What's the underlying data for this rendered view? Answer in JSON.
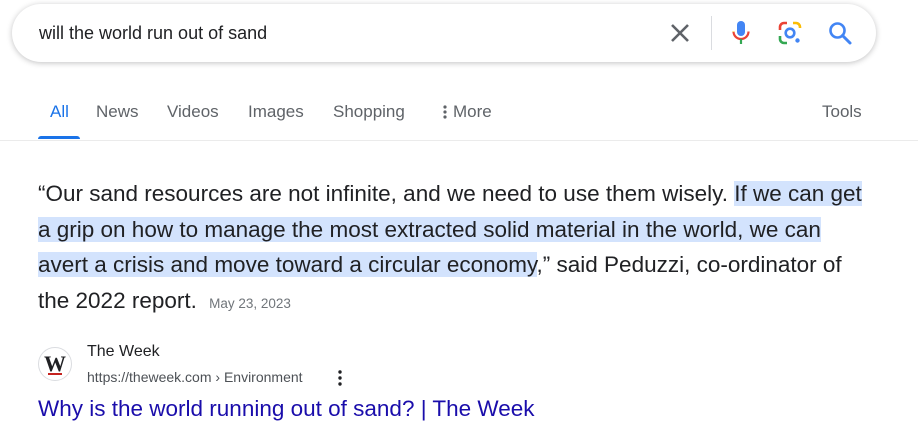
{
  "search": {
    "query": "will the world run out of sand"
  },
  "icons": {
    "clear": "close-icon",
    "mic": "microphone-icon",
    "lens": "google-lens-icon",
    "search": "search-icon",
    "more": "vertical-dots-icon"
  },
  "tabs": {
    "items": [
      {
        "label": "All",
        "active": true
      },
      {
        "label": "News"
      },
      {
        "label": "Videos"
      },
      {
        "label": "Images"
      },
      {
        "label": "Shopping"
      },
      {
        "label": "More"
      }
    ],
    "tools_label": "Tools"
  },
  "snippet": {
    "text_plain": "“Our sand resources are not infinite, and we need to use them wisely. ",
    "text_highlighted": "If we can get a grip on how to manage the most extracted solid material in the world, we can avert a crisis and move toward a circular economy",
    "text_after": ",” said Peduzzi, co-ordinator of the 2022 report.",
    "date": "May 23, 2023"
  },
  "source": {
    "site_name": "The Week",
    "favicon_letter": "W",
    "url": "https://theweek.com › Environment",
    "title": "Why is the world running out of sand? | The Week"
  },
  "colors": {
    "accent": "#1a73e8",
    "link": "#1a0dab",
    "highlight": "#d3e3fd"
  }
}
